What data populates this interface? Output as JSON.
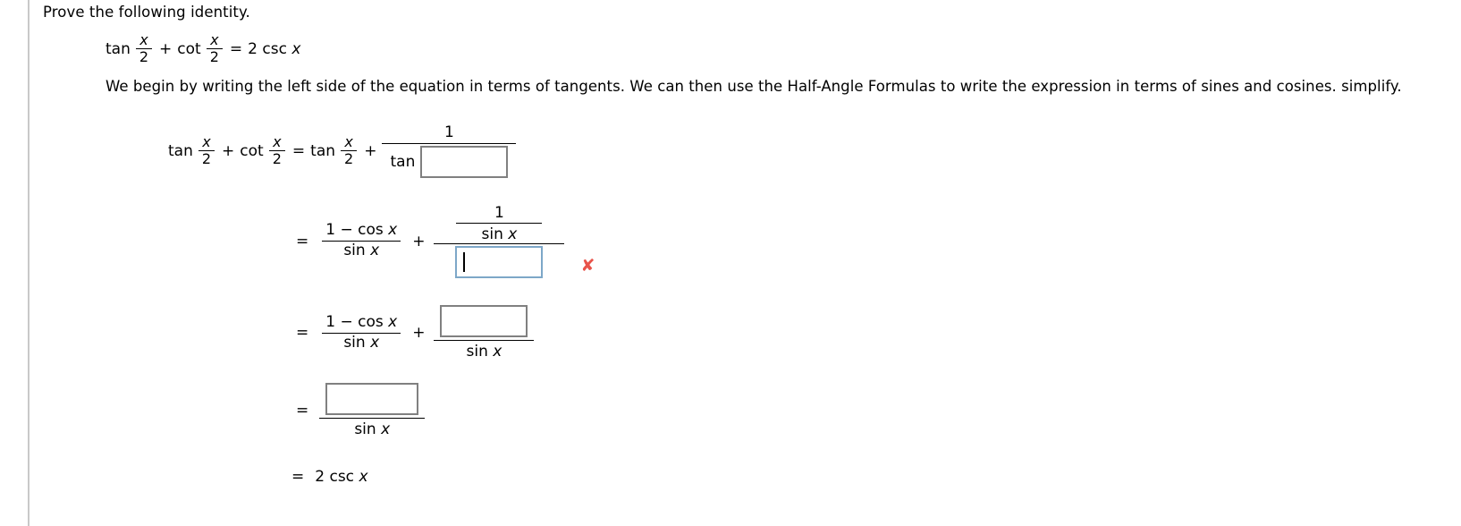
{
  "problem": {
    "instruction": "Prove the following identity.",
    "identity": {
      "tan": "tan",
      "cot": "cot",
      "x": "x",
      "two": "2",
      "plus": "+",
      "equals": "=",
      "rhs_coeff": "2",
      "csc": "csc"
    },
    "explanation": "We begin by writing the left side of the equation in terms of tangents. We can then use the Half-Angle Formulas to write the expression in terms of sines and cosines. simplify."
  },
  "symbols": {
    "tan": "tan",
    "cot": "cot",
    "sin": "sin",
    "cos": "cos",
    "csc": "csc",
    "x": "x",
    "one": "1",
    "two": "2",
    "plus": "+",
    "minus": "−",
    "equals": "=",
    "sin_x": "sin x",
    "cos_x": "cos x",
    "one_minus_cos_x": "1 − cos x",
    "two_csc_x": "2 csc x"
  },
  "steps": [
    {
      "id": "step-1",
      "lhs": "tan x/2 + cot x/2",
      "relation": "=",
      "rhs_lead": "tan x/2 +",
      "fraction_numerator": "1",
      "fraction_denominator_label": "tan",
      "input": {
        "value": "",
        "focused": false,
        "status": "empty"
      }
    },
    {
      "id": "step-2",
      "relation": "=",
      "left_fraction": {
        "numerator": "1 − cos x",
        "denominator": "sin x"
      },
      "operator": "+",
      "right_fraction": {
        "numerator_fraction": {
          "numerator": "1",
          "denominator": "sin x"
        },
        "denominator_input": {
          "value": "",
          "focused": true,
          "status": "incorrect"
        }
      },
      "feedback_icon": "x-mark-incorrect-icon",
      "feedback_symbol": "✘"
    },
    {
      "id": "step-3",
      "relation": "=",
      "left_fraction": {
        "numerator": "1 − cos x",
        "denominator": "sin x"
      },
      "operator": "+",
      "right_fraction": {
        "numerator_input": {
          "value": "",
          "focused": false,
          "status": "empty"
        },
        "denominator": "sin x"
      }
    },
    {
      "id": "step-4",
      "relation": "=",
      "fraction": {
        "numerator_input": {
          "value": "",
          "focused": false,
          "status": "empty"
        },
        "denominator": "sin x"
      }
    },
    {
      "id": "step-5",
      "relation": "=",
      "result": "2 csc x"
    }
  ],
  "colors": {
    "input_border": "#808080",
    "input_border_focused": "#7da7c8",
    "incorrect_mark": "#e8534a",
    "left_rule": "#c9c9c9",
    "text": "#000000",
    "background": "#ffffff"
  }
}
